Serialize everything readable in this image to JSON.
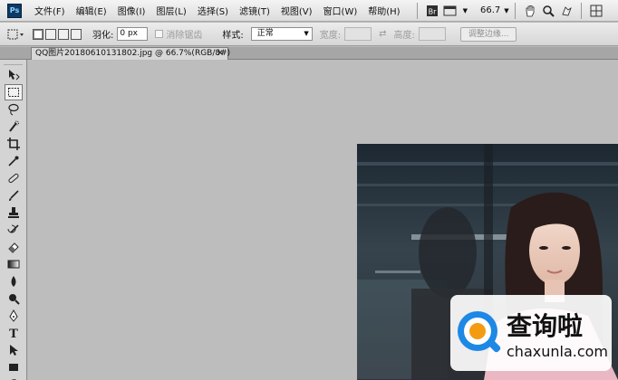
{
  "app": {
    "logo_text": "Ps"
  },
  "menu": [
    {
      "label": "文件(F)"
    },
    {
      "label": "编辑(E)"
    },
    {
      "label": "图像(I)"
    },
    {
      "label": "图层(L)"
    },
    {
      "label": "选择(S)"
    },
    {
      "label": "滤镜(T)"
    },
    {
      "label": "视图(V)"
    },
    {
      "label": "窗口(W)"
    },
    {
      "label": "帮助(H)"
    }
  ],
  "menubar_tools": {
    "zoom_value": "66.7",
    "icons": [
      "bridge-icon",
      "screen-mode-icon",
      "hand-icon",
      "zoom-icon",
      "rotate-view-icon",
      "arrange-icon"
    ]
  },
  "options": {
    "feather_label": "羽化:",
    "feather_value": "0 px",
    "antialias_label": "消除锯齿",
    "style_label": "样式:",
    "style_value": "正常",
    "width_label": "宽度:",
    "height_label": "高度:",
    "refine_edge_label": "调整边缘..."
  },
  "document": {
    "tab_title": "QQ图片20180610131802.jpg @ 66.7%(RGB/8#)",
    "close_glyph": "×"
  },
  "tools": [
    {
      "name": "move-tool"
    },
    {
      "name": "marquee-tool",
      "active": true
    },
    {
      "name": "lasso-tool"
    },
    {
      "name": "quick-selection-tool"
    },
    {
      "name": "crop-tool"
    },
    {
      "name": "eyedropper-tool"
    },
    {
      "name": "healing-brush-tool"
    },
    {
      "name": "brush-tool"
    },
    {
      "name": "clone-stamp-tool"
    },
    {
      "name": "history-brush-tool"
    },
    {
      "name": "eraser-tool"
    },
    {
      "name": "gradient-tool"
    },
    {
      "name": "blur-tool"
    },
    {
      "name": "dodge-tool"
    },
    {
      "name": "pen-tool"
    },
    {
      "name": "type-tool"
    },
    {
      "name": "path-selection-tool"
    },
    {
      "name": "shape-tool"
    },
    {
      "name": "hand-tool"
    }
  ],
  "watermark": {
    "title": "查询啦",
    "url": "chaxunla.com",
    "accent_blue": "#1e88e5",
    "accent_orange": "#f39c12"
  }
}
